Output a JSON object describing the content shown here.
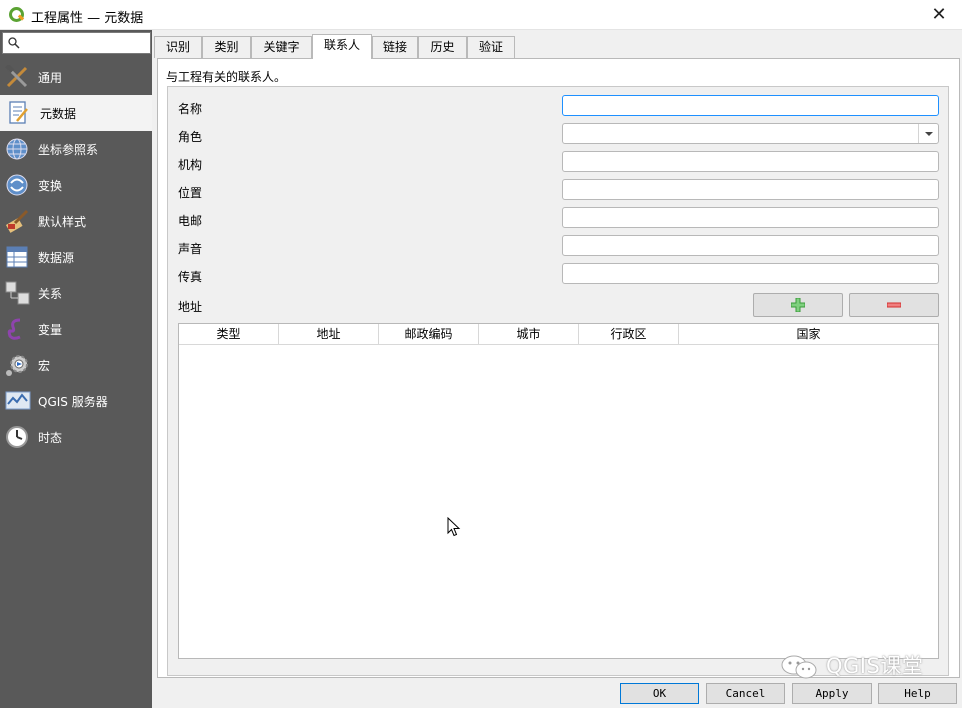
{
  "window": {
    "title": "工程属性 — 元数据",
    "close_icon": "close-icon"
  },
  "sidebar": {
    "search_placeholder": "",
    "items": [
      {
        "label": "通用",
        "icon": "general-icon"
      },
      {
        "label": "元数据",
        "icon": "metadata-icon",
        "active": true
      },
      {
        "label": "坐标参照系",
        "icon": "crs-icon"
      },
      {
        "label": "变换",
        "icon": "transform-icon"
      },
      {
        "label": "默认样式",
        "icon": "default-styles-icon"
      },
      {
        "label": "数据源",
        "icon": "data-sources-icon"
      },
      {
        "label": "关系",
        "icon": "relations-icon"
      },
      {
        "label": "变量",
        "icon": "variables-icon"
      },
      {
        "label": "宏",
        "icon": "macros-icon"
      },
      {
        "label": "QGIS 服务器",
        "icon": "qgis-server-icon"
      },
      {
        "label": "时态",
        "icon": "temporal-icon"
      }
    ]
  },
  "tabs": [
    {
      "label": "识别"
    },
    {
      "label": "类别"
    },
    {
      "label": "关键字"
    },
    {
      "label": "联系人",
      "active": true
    },
    {
      "label": "链接"
    },
    {
      "label": "历史"
    },
    {
      "label": "验证"
    }
  ],
  "contact": {
    "description": "与工程有关的联系人。",
    "fields": [
      {
        "label": "名称",
        "value": ""
      },
      {
        "label": "角色",
        "value": ""
      },
      {
        "label": "机构",
        "value": ""
      },
      {
        "label": "位置",
        "value": ""
      },
      {
        "label": "电邮",
        "value": ""
      },
      {
        "label": "声音",
        "value": ""
      },
      {
        "label": "传真",
        "value": ""
      }
    ],
    "address_label": "地址",
    "address_columns": [
      "类型",
      "地址",
      "邮政编码",
      "城市",
      "行政区",
      "国家"
    ],
    "address_rows": []
  },
  "buttons": {
    "ok": "OK",
    "cancel": "Cancel",
    "apply": "Apply",
    "help": "Help"
  },
  "colors": {
    "sidebar_bg": "#595959",
    "focus": "#1e90ff",
    "add_green": "#3a9a3a",
    "remove_red": "#d23030"
  },
  "watermark": "QGIS课堂"
}
